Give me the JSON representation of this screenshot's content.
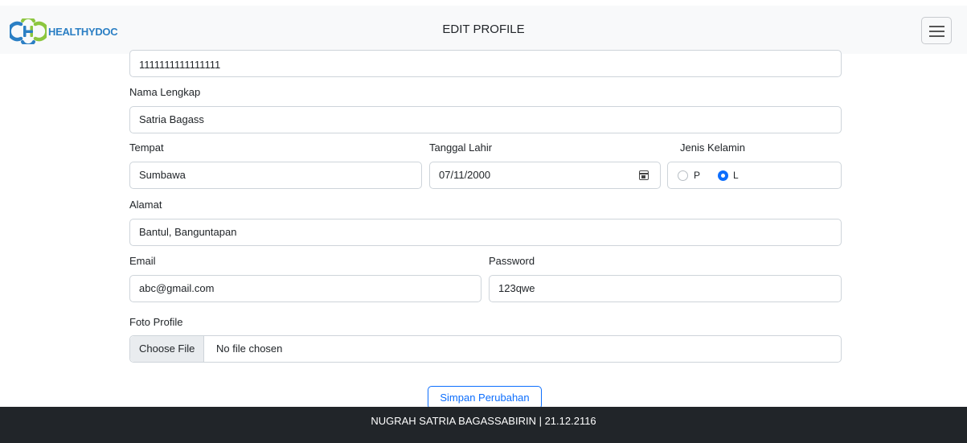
{
  "navbar": {
    "brand": "HEALTHYDOC",
    "title": "EDIT PROFILE",
    "menu_icon": "hamburger-icon",
    "brand_colors": {
      "blue": "#2b7fc4",
      "green": "#8cc63f"
    }
  },
  "form": {
    "nik_value": "1111111111111111",
    "nama": {
      "label": "Nama Lengkap",
      "value": "Satria Bagass"
    },
    "tempat": {
      "label": "Tempat",
      "value": "Sumbawa"
    },
    "tanggal_lahir": {
      "label": "Tanggal Lahir",
      "value": "07/11/2000",
      "icon": "calendar-icon"
    },
    "jenis_kelamin": {
      "label": "Jenis Kelamin",
      "options": [
        "P",
        "L"
      ],
      "selected": "L"
    },
    "alamat": {
      "label": "Alamat",
      "value": "Bantul, Banguntapan"
    },
    "email": {
      "label": "Email",
      "value": "abc@gmail.com"
    },
    "password": {
      "label": "Password",
      "value": "123qwe"
    },
    "foto": {
      "label": "Foto Profile",
      "button": "Choose File",
      "status": "No file chosen"
    },
    "submit": "Simpan Perubahan"
  },
  "footer": {
    "text": "NUGRAH SATRIA BAGASSABIRIN | 21.12.2116"
  },
  "colors": {
    "primary": "#0d6efd",
    "footer_bg": "#212529",
    "navbar_bg": "#f8f9fa"
  }
}
